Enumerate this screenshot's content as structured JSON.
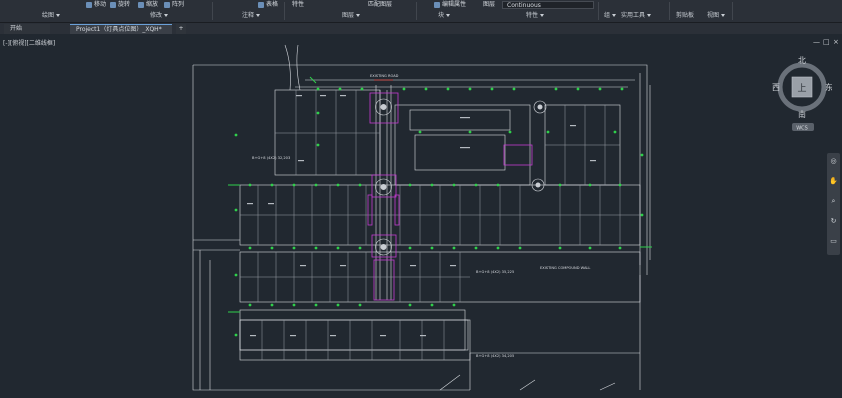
{
  "ribbon": {
    "toprow": {
      "move": "移动",
      "rotate": "旋转",
      "scale": "缩放",
      "array": "阵列",
      "table": "表格",
      "match_properties": "特性",
      "edit_attributes": "编辑属性",
      "match_layer": "匹配图层",
      "layer_state": "图层",
      "linetype": "Continuous"
    },
    "panels": [
      {
        "label": "绘图"
      },
      {
        "label": "修改"
      },
      {
        "label": "注释"
      },
      {
        "label": "图层"
      },
      {
        "label": "块"
      },
      {
        "label": "特性"
      },
      {
        "label": "组"
      },
      {
        "label": "实用工具"
      },
      {
        "label": "剪贴板"
      },
      {
        "label": "视图"
      }
    ]
  },
  "tabs": {
    "start": "开始",
    "doc": "Project1（灯具点位图）_XQH*",
    "plus": "+"
  },
  "viewport": {
    "label": "[-][俯视][二维线框]",
    "window_controls": [
      "—",
      "□",
      "×"
    ]
  },
  "viewcube": {
    "north": "北",
    "south": "南",
    "east": "东",
    "west": "西",
    "top": "上",
    "wcs": "WCS"
  },
  "drawing": {
    "road_label_top": "EXISTING ROAD",
    "road_label_mid": "EXISTING COMPOUND WALL",
    "road_label_left": "EXISTING ROAD",
    "label_a": "B+G+8 (4X2) 32,203",
    "label_b": "B+G+8 (4X2) 35,225",
    "label_c": "B+G+8 (4X2) 34,205",
    "colors": {
      "lines": "#d8dbe0",
      "green": "#2fd04b",
      "magenta": "#c43bd1",
      "bg": "#212830"
    }
  }
}
